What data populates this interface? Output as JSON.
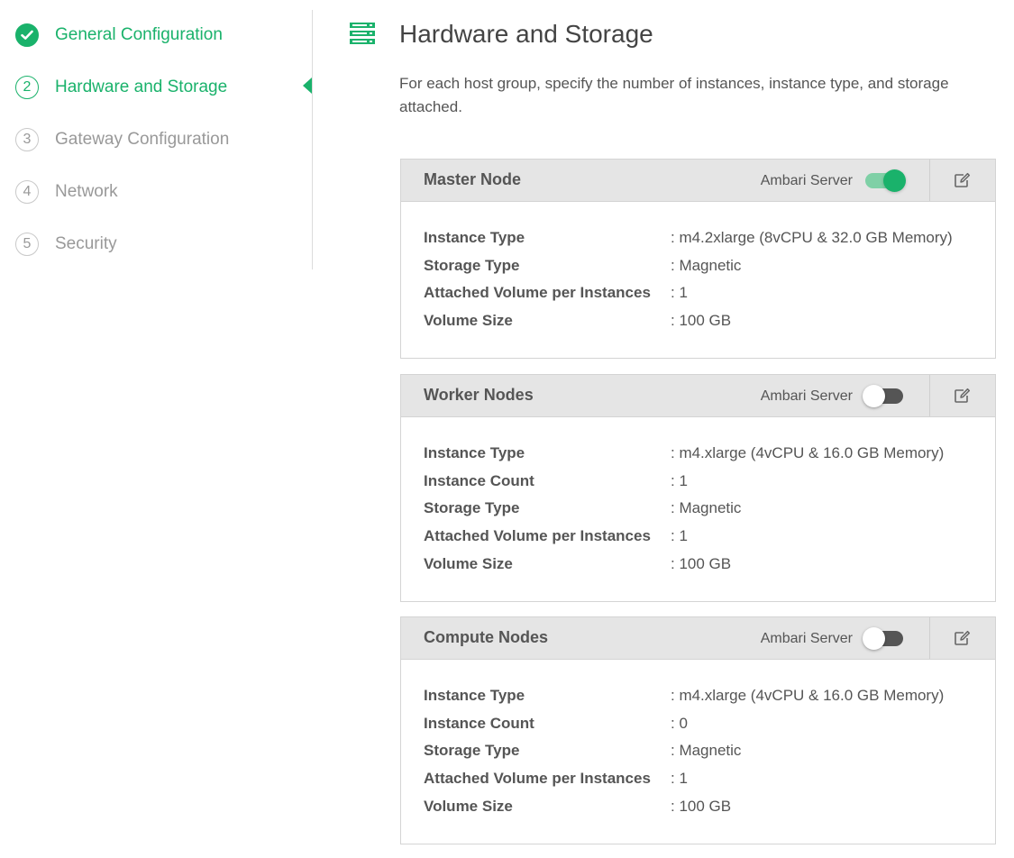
{
  "sidebar": {
    "steps": [
      {
        "number": "1",
        "label": "General Configuration",
        "state": "completed"
      },
      {
        "number": "2",
        "label": "Hardware and Storage",
        "state": "current"
      },
      {
        "number": "3",
        "label": "Gateway Configuration",
        "state": "pending"
      },
      {
        "number": "4",
        "label": "Network",
        "state": "pending"
      },
      {
        "number": "5",
        "label": "Security",
        "state": "pending"
      }
    ]
  },
  "header": {
    "icon": "server-stack-icon",
    "title": "Hardware and Storage",
    "description": "For each host group, specify the number of instances, instance type, and storage attached."
  },
  "colors": {
    "accent": "#1ab26b",
    "muted": "#999999",
    "card_header_bg": "#e5e5e5"
  },
  "host_groups": [
    {
      "name": "Master Node",
      "ambari_label": "Ambari Server",
      "ambari_server_enabled": true,
      "fields": [
        {
          "label": "Instance Type",
          "value": ": m4.2xlarge (8vCPU & 32.0 GB Memory)"
        },
        {
          "label": "Storage Type",
          "value": ": Magnetic"
        },
        {
          "label": "Attached Volume per Instances",
          "value": ": 1"
        },
        {
          "label": "Volume Size",
          "value": ": 100 GB"
        }
      ]
    },
    {
      "name": "Worker Nodes",
      "ambari_label": "Ambari Server",
      "ambari_server_enabled": false,
      "fields": [
        {
          "label": "Instance Type",
          "value": ": m4.xlarge (4vCPU & 16.0 GB Memory)"
        },
        {
          "label": "Instance Count",
          "value": ": 1"
        },
        {
          "label": "Storage Type",
          "value": ": Magnetic"
        },
        {
          "label": "Attached Volume per Instances",
          "value": ": 1"
        },
        {
          "label": "Volume Size",
          "value": ": 100 GB"
        }
      ]
    },
    {
      "name": "Compute Nodes",
      "ambari_label": "Ambari Server",
      "ambari_server_enabled": false,
      "fields": [
        {
          "label": "Instance Type",
          "value": ": m4.xlarge (4vCPU & 16.0 GB Memory)"
        },
        {
          "label": "Instance Count",
          "value": ": 0"
        },
        {
          "label": "Storage Type",
          "value": ": Magnetic"
        },
        {
          "label": "Attached Volume per Instances",
          "value": ": 1"
        },
        {
          "label": "Volume Size",
          "value": ": 100 GB"
        }
      ]
    }
  ]
}
